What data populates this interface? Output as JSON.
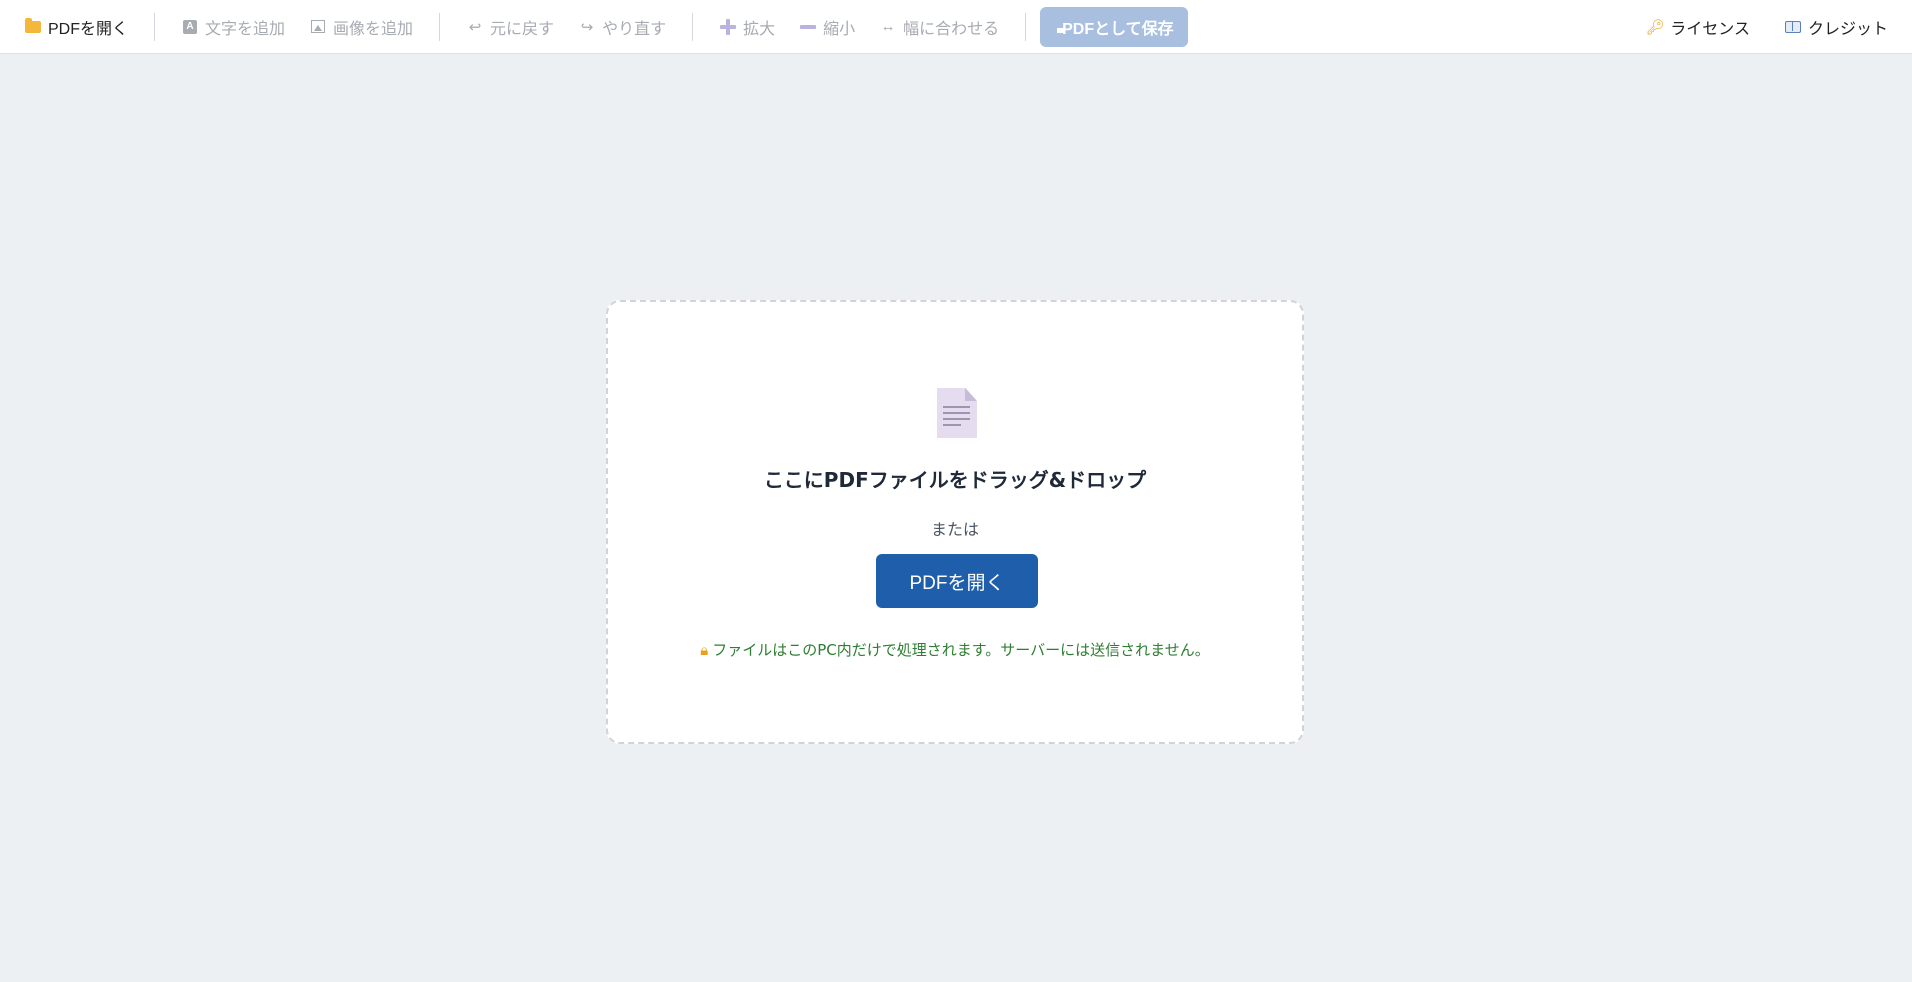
{
  "toolbar": {
    "open_pdf": "PDFを開く",
    "add_text": "文字を追加",
    "add_image": "画像を追加",
    "undo": "元に戻す",
    "redo": "やり直す",
    "zoom_in": "拡大",
    "zoom_out": "縮小",
    "fit_width": "幅に合わせる",
    "save_pdf": "PDFとして保存",
    "license": "ライセンス",
    "credits": "クレジット",
    "icons": {
      "open_pdf": "folder-icon",
      "add_text": "text-box-icon",
      "add_image": "image-icon",
      "undo": "undo-arrow-icon",
      "redo": "redo-arrow-icon",
      "zoom_in": "plus-icon",
      "zoom_out": "minus-icon",
      "fit_width": "horizontal-arrows-icon",
      "save_pdf": "floppy-disk-icon",
      "license": "key-icon",
      "credits": "book-icon"
    }
  },
  "dropzone": {
    "title": "ここにPDFファイルをドラッグ&ドロップ",
    "or_text": "または",
    "open_button": "PDFを開く",
    "privacy_note": "ファイルはこのPC内だけで処理されます。サーバーには送信されません。"
  },
  "colors": {
    "background": "#edf0f3",
    "primary": "#1e5eaa",
    "save_disabled": "#a8bfdf",
    "note_green": "#2e7d32"
  }
}
